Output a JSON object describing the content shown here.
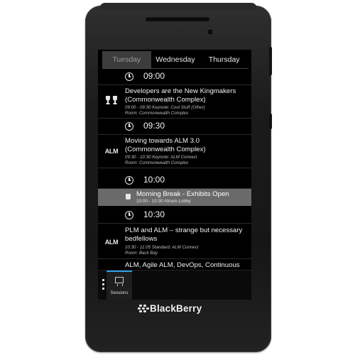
{
  "tabs": [
    {
      "label": "Tuesday",
      "active": true
    },
    {
      "label": "Wednesday",
      "active": false
    },
    {
      "label": "Thursday",
      "active": false
    }
  ],
  "schedule": {
    "time_0900": "09:00",
    "session1": {
      "icon": "trophy-icon",
      "title": "Developers are the New Kingmakers (Commonwealth Complex)",
      "detail": "09:00 - 09:30 Keynote: Cool Stuff (Other)",
      "room": "Room: Commonwealth Complex"
    },
    "time_0930": "09:30",
    "session2": {
      "icon_text": "ALM",
      "title": "Moving towards ALM 3.0 (Commonwealth Complex)",
      "detail": "09:30 - 10:30 Keynote: ALM Connect",
      "room": "Room: Commonwealth Complex"
    },
    "time_1000": "10:00",
    "break": {
      "icon": "coffee-cup-icon",
      "title": "Morning Break - Exhibits Open",
      "detail": "10:00 - 10:30  Atrium Lobby"
    },
    "time_1030": "10:30",
    "session3": {
      "icon_text": "ALM",
      "title": "PLM and ALM – strange but necessary bedfellows",
      "detail": "10:30 - 11:05 Standard: ALM Connect",
      "room": "Room: Back Bay"
    },
    "session4": {
      "title": "ALM, Agile ALM, DevOps, Continuous"
    }
  },
  "bottom_bar": {
    "sessions_label": "Sessions",
    "accent": "#2ea0e6"
  },
  "brand": {
    "name": "BlackBerry"
  }
}
